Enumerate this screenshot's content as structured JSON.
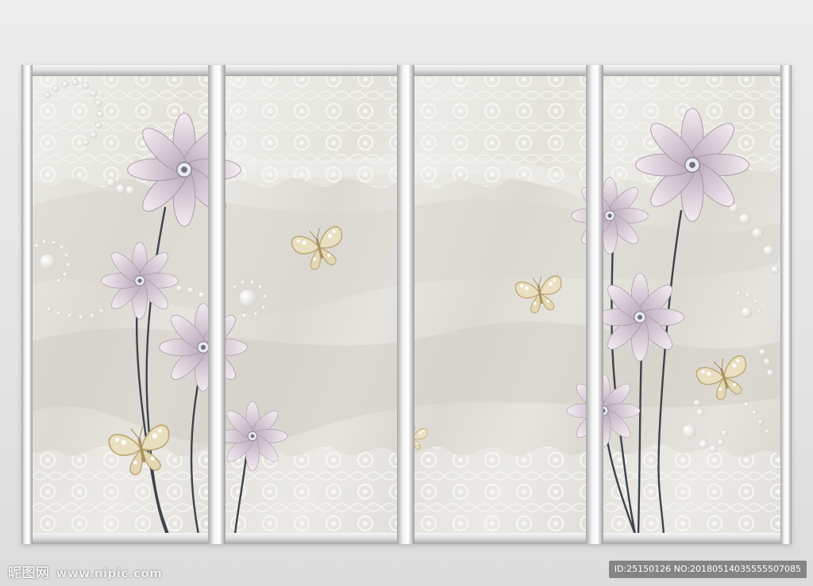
{
  "watermark": {
    "brand": "昵图网",
    "site": "www.nipic.com",
    "id_label": "ID:25150126 NO:20180514035555507085"
  },
  "colors": {
    "background": "#e8e8e8",
    "panel_fabric": "#e3e1da",
    "lace": "#f7f7f3",
    "petal": "#c9b7c4",
    "petal_light": "#eee4ea",
    "stem": "#3d434b",
    "butterfly": "#d8c59a",
    "pearl": "#fbfbf9",
    "frame_bar": "#c8c8c8"
  },
  "panels": [
    {
      "id": "panel-1",
      "content": [
        "pearl-swirl",
        "flower-large",
        "flower-medium",
        "flower-small",
        "butterfly"
      ]
    },
    {
      "id": "panel-2",
      "content": [
        "pearl-swirl",
        "flower-small",
        "butterfly"
      ]
    },
    {
      "id": "panel-3",
      "content": [
        "butterfly",
        "butterfly"
      ]
    },
    {
      "id": "panel-4",
      "content": [
        "flower-large",
        "flower-medium",
        "flower-small",
        "butterfly",
        "pearl-swirl"
      ]
    }
  ]
}
